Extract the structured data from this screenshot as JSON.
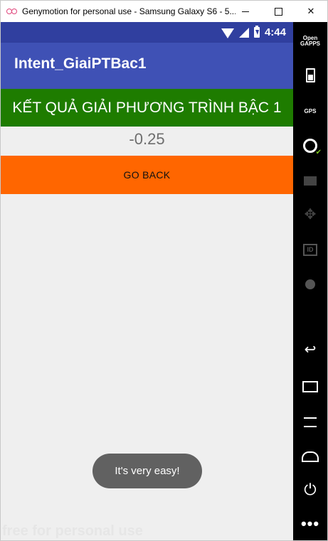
{
  "window": {
    "title": "Genymotion for personal use - Samsung Galaxy S6 - 5...",
    "minimize_icon": "minimize-icon",
    "maximize_icon": "maximize-icon",
    "close_glyph": "✕"
  },
  "status_bar": {
    "time": "4:44"
  },
  "app": {
    "title": "Intent_GiaiPTBac1",
    "header_text": "KẾT QUẢ GIẢI PHƯƠNG TRÌNH BẬC 1",
    "result_value": "-0.25",
    "go_back_label": "GO BACK"
  },
  "toast": {
    "message": "It's very easy!"
  },
  "watermark": {
    "text": "free for personal use"
  },
  "sidebar": {
    "opengapps_line1": "Open",
    "opengapps_line2": "GAPPS",
    "gps_label": "GPS",
    "id_label": "ID",
    "back_glyph": "↩",
    "power_glyph": "⏻",
    "more_glyph": "•••",
    "dpad_glyph": "✥"
  },
  "colors": {
    "status_bar": "#303f9f",
    "action_bar": "#3f51b5",
    "header_banner": "#1e7c00",
    "button": "#ff6600",
    "toast": "#616161",
    "background": "#efefef"
  }
}
